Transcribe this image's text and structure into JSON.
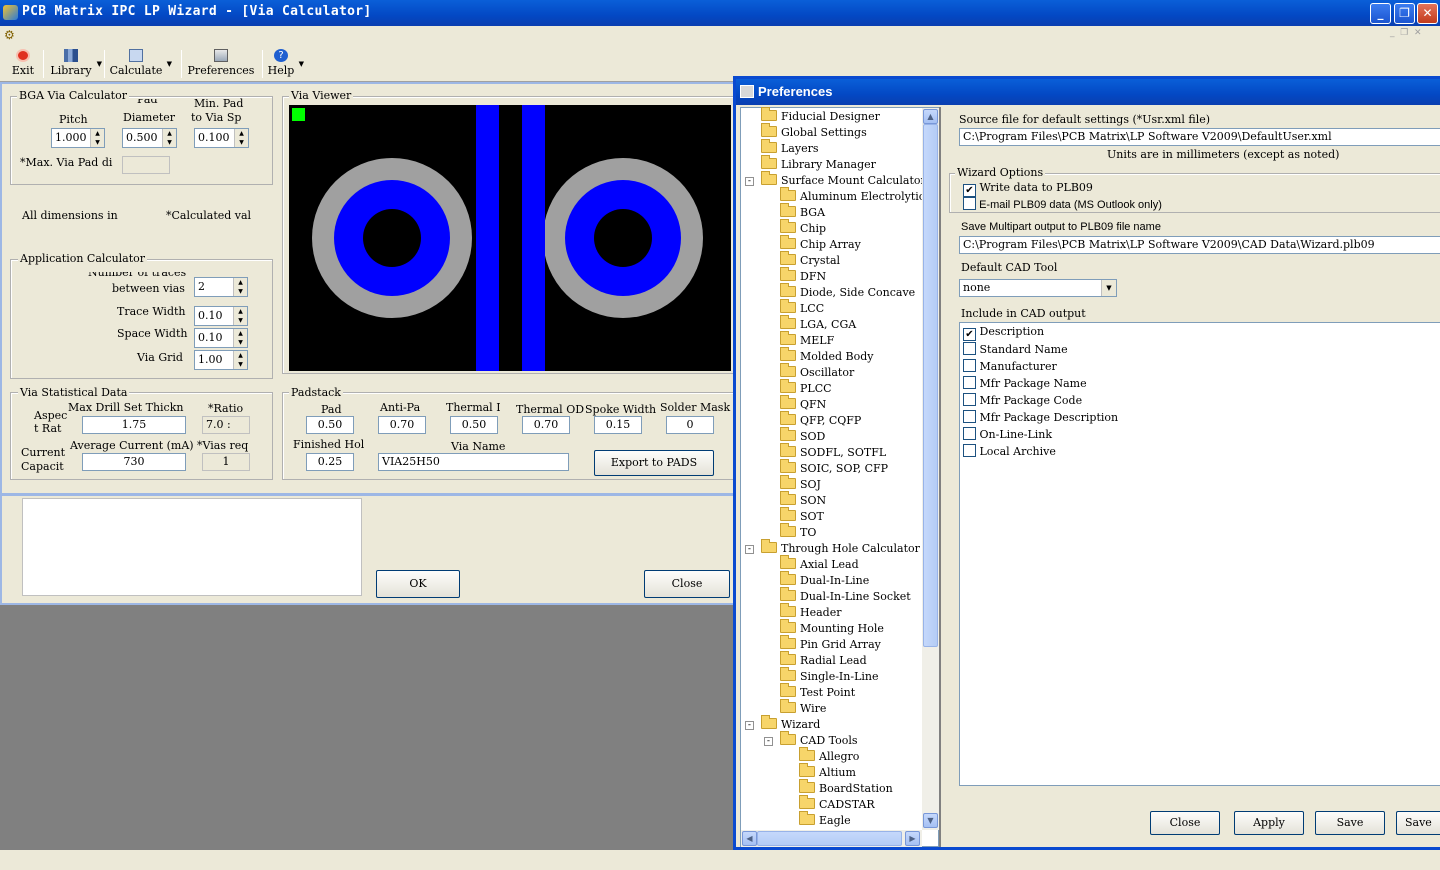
{
  "app": {
    "title": "PCB Matrix IPC LP Wizard - [Via Calculator]",
    "window_controls": {
      "minimize": "_",
      "restore": "❐",
      "close": "✕"
    }
  },
  "toolbar": {
    "exit": "Exit",
    "library": "Library",
    "calculate": "Calculate",
    "preferences": "Preferences",
    "help": "Help"
  },
  "bga": {
    "legend": "BGA Via Calculator",
    "pitch_label": "Pitch",
    "pitch_value": "1.000",
    "pad_diam_label_1": "Pad",
    "pad_diam_label_2": "Diameter",
    "pad_diam_value": "0.500",
    "min_pad_label_1": "Min. Pad",
    "min_pad_label_2": "to Via Sp",
    "min_pad_value": "0.100",
    "max_via_label": "*Max. Via Pad di",
    "max_via_value": ""
  },
  "notes": {
    "all_dims": "All dimensions in",
    "calc_vals": "*Calculated val"
  },
  "app_calc": {
    "legend": "Application Calculator",
    "num_traces_label_1": "Number of traces",
    "num_traces_label_2": "between vias",
    "num_traces_value": "2",
    "trace_width_label": "Trace Width",
    "trace_width_value": "0.10",
    "space_width_label": "Space Width",
    "space_width_value": "0.10",
    "via_grid_label": "Via Grid",
    "via_grid_value": "1.00"
  },
  "stat": {
    "legend": "Via Statistical Data",
    "aspect_label_1": "Aspec",
    "aspect_label_2": "t Rat",
    "max_drill_label": "Max Drill Set Thickn",
    "max_drill_value": "1.75",
    "ratio_label": "*Ratio",
    "ratio_value": "7.0 :",
    "current_label_1": "Current",
    "current_label_2": "Capacit",
    "avg_current_label": "Average Current (mA)",
    "avg_current_value": "730",
    "vias_req_label": "*Vias req",
    "vias_req_value": "1"
  },
  "viewer": {
    "legend": "Via Viewer"
  },
  "padstack": {
    "legend": "Padstack",
    "pad_label": "Pad",
    "pad_value": "0.50",
    "antipad_label": "Anti-Pa",
    "antipad_value": "0.70",
    "thermal_id_label": "Thermal I",
    "thermal_id_value": "0.50",
    "thermal_od_label": "Thermal OD",
    "thermal_od_value": "0.70",
    "spoke_label": "Spoke Width",
    "spoke_value": "0.15",
    "solder_mask_label": "Solder Mask",
    "solder_mask_value": "0",
    "finished_hole_label": "Finished Hol",
    "finished_hole_value": "0.25",
    "via_name_label": "Via Name",
    "via_name_value": "VIA25H50",
    "export_button": "Export to PADS"
  },
  "bottom": {
    "ok": "OK",
    "close": "Close"
  },
  "preferences": {
    "title": "Preferences",
    "tree": [
      {
        "label": "Fiducial Designer",
        "level": 0,
        "exp": ""
      },
      {
        "label": "Global Settings",
        "level": 0,
        "exp": ""
      },
      {
        "label": "Layers",
        "level": 0,
        "exp": ""
      },
      {
        "label": "Library Manager",
        "level": 0,
        "exp": ""
      },
      {
        "label": "Surface Mount Calculator",
        "level": 0,
        "exp": "-"
      },
      {
        "label": "Aluminum Electrolytic",
        "level": 1,
        "exp": ""
      },
      {
        "label": "BGA",
        "level": 1,
        "exp": ""
      },
      {
        "label": "Chip",
        "level": 1,
        "exp": ""
      },
      {
        "label": "Chip Array",
        "level": 1,
        "exp": ""
      },
      {
        "label": "Crystal",
        "level": 1,
        "exp": ""
      },
      {
        "label": "DFN",
        "level": 1,
        "exp": ""
      },
      {
        "label": "Diode, Side Concave",
        "level": 1,
        "exp": ""
      },
      {
        "label": "LCC",
        "level": 1,
        "exp": ""
      },
      {
        "label": "LGA, CGA",
        "level": 1,
        "exp": ""
      },
      {
        "label": "MELF",
        "level": 1,
        "exp": ""
      },
      {
        "label": "Molded Body",
        "level": 1,
        "exp": ""
      },
      {
        "label": "Oscillator",
        "level": 1,
        "exp": ""
      },
      {
        "label": "PLCC",
        "level": 1,
        "exp": ""
      },
      {
        "label": "QFN",
        "level": 1,
        "exp": ""
      },
      {
        "label": "QFP, CQFP",
        "level": 1,
        "exp": ""
      },
      {
        "label": "SOD",
        "level": 1,
        "exp": ""
      },
      {
        "label": "SODFL, SOTFL",
        "level": 1,
        "exp": ""
      },
      {
        "label": "SOIC, SOP, CFP",
        "level": 1,
        "exp": ""
      },
      {
        "label": "SOJ",
        "level": 1,
        "exp": ""
      },
      {
        "label": "SON",
        "level": 1,
        "exp": ""
      },
      {
        "label": "SOT",
        "level": 1,
        "exp": ""
      },
      {
        "label": "TO",
        "level": 1,
        "exp": ""
      },
      {
        "label": "Through Hole Calculator",
        "level": 0,
        "exp": "-"
      },
      {
        "label": "Axial Lead",
        "level": 1,
        "exp": ""
      },
      {
        "label": "Dual-In-Line",
        "level": 1,
        "exp": ""
      },
      {
        "label": "Dual-In-Line Socket",
        "level": 1,
        "exp": ""
      },
      {
        "label": "Header",
        "level": 1,
        "exp": ""
      },
      {
        "label": "Mounting Hole",
        "level": 1,
        "exp": ""
      },
      {
        "label": "Pin Grid Array",
        "level": 1,
        "exp": ""
      },
      {
        "label": "Radial Lead",
        "level": 1,
        "exp": ""
      },
      {
        "label": "Single-In-Line",
        "level": 1,
        "exp": ""
      },
      {
        "label": "Test Point",
        "level": 1,
        "exp": ""
      },
      {
        "label": "Wire",
        "level": 1,
        "exp": ""
      },
      {
        "label": "Wizard",
        "level": 0,
        "exp": "-"
      },
      {
        "label": "CAD Tools",
        "level": 1,
        "exp": "-"
      },
      {
        "label": "Allegro",
        "level": 2,
        "exp": ""
      },
      {
        "label": "Altium",
        "level": 2,
        "exp": ""
      },
      {
        "label": "BoardStation",
        "level": 2,
        "exp": ""
      },
      {
        "label": "CADSTAR",
        "level": 2,
        "exp": ""
      },
      {
        "label": "Eagle",
        "level": 2,
        "exp": ""
      }
    ],
    "source_label": "Source file for default settings (*Usr.xml file)",
    "source_value": "C:\\Program Files\\PCB Matrix\\LP Software V2009\\DefaultUser.xml",
    "units_note": "Units are in millimeters (except as noted)",
    "wizard_options_legend": "Wizard Options",
    "write_plb09": "Write data to PLB09",
    "email_plb09": "E-mail PLB09 data  (MS Outlook only)",
    "save_multipart_label": "Save Multipart output to PLB09 file name",
    "save_multipart_value": "C:\\Program Files\\PCB Matrix\\LP Software V2009\\CAD Data\\Wizard.plb09",
    "default_cad_label": "Default CAD Tool",
    "default_cad_value": "none",
    "include_label": "Include in CAD output",
    "include_items": [
      {
        "label": "Description",
        "checked": "✔"
      },
      {
        "label": "Standard Name",
        "checked": ""
      },
      {
        "label": "Manufacturer",
        "checked": ""
      },
      {
        "label": "Mfr Package Name",
        "checked": ""
      },
      {
        "label": "Mfr Package Code",
        "checked": ""
      },
      {
        "label": "Mfr Package Description",
        "checked": ""
      },
      {
        "label": "On-Line-Link",
        "checked": ""
      },
      {
        "label": "Local Archive",
        "checked": ""
      }
    ],
    "buttons": {
      "close": "Close",
      "apply": "Apply",
      "save": "Save",
      "save_as": "Save"
    }
  },
  "colors": {
    "copper": "#0000ff",
    "antipad": "#a0a0a0",
    "marker": "#00ff00",
    "titlebar": "#0348c4"
  }
}
